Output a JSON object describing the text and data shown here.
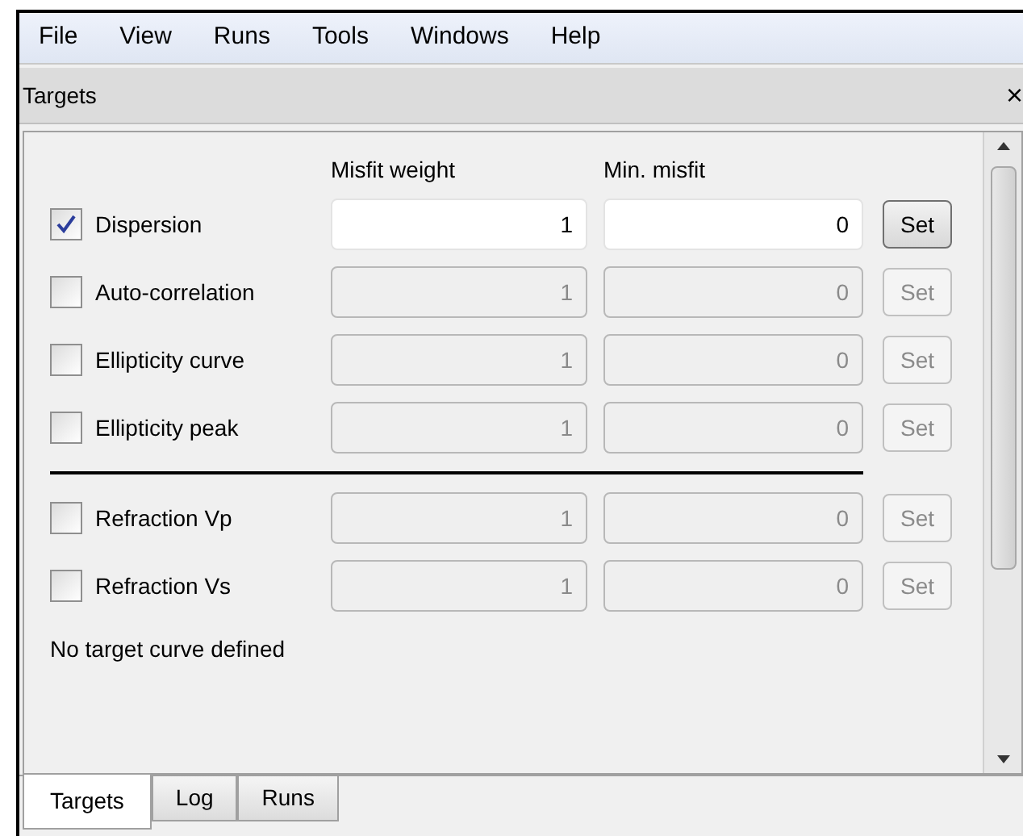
{
  "menu": [
    "File",
    "View",
    "Runs",
    "Tools",
    "Windows",
    "Help"
  ],
  "panel": {
    "title": "Targets",
    "close": "×"
  },
  "columns": [
    "Misfit weight",
    "Min. misfit"
  ],
  "target_groups": [
    [
      {
        "label": "Dispersion",
        "checked": true,
        "weight": "1",
        "min_misfit": "0",
        "button": "Set"
      },
      {
        "label": "Auto-correlation",
        "checked": false,
        "weight": "1",
        "min_misfit": "0",
        "button": "Set"
      },
      {
        "label": "Ellipticity curve",
        "checked": false,
        "weight": "1",
        "min_misfit": "0",
        "button": "Set"
      },
      {
        "label": "Ellipticity peak",
        "checked": false,
        "weight": "1",
        "min_misfit": "0",
        "button": "Set"
      }
    ],
    [
      {
        "label": "Refraction Vp",
        "checked": false,
        "weight": "1",
        "min_misfit": "0",
        "button": "Set"
      },
      {
        "label": "Refraction Vs",
        "checked": false,
        "weight": "1",
        "min_misfit": "0",
        "button": "Set"
      }
    ]
  ],
  "status": "No target curve defined",
  "tabs": [
    {
      "label": "Targets",
      "selected": true
    },
    {
      "label": "Log",
      "selected": false
    },
    {
      "label": "Runs",
      "selected": false
    }
  ]
}
